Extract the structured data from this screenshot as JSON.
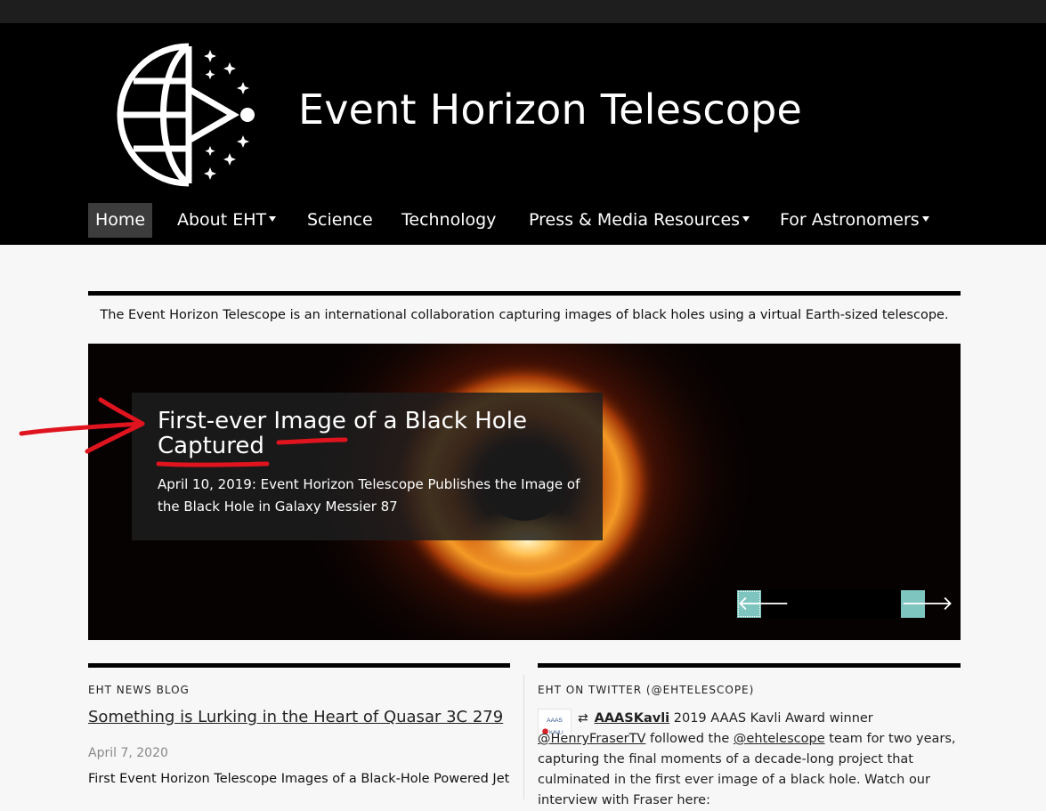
{
  "site": {
    "title": "Event Horizon Telescope"
  },
  "nav": {
    "items": [
      {
        "label": "Home",
        "active": true
      },
      {
        "label": "About EHT",
        "dropdown": true
      },
      {
        "label": "Science"
      },
      {
        "label": "Technology"
      },
      {
        "label": "Press & Media Resources",
        "dropdown": true
      },
      {
        "label": "For Astronomers",
        "dropdown": true
      }
    ]
  },
  "tagline": "The Event Horizon Telescope is an international collaboration capturing images of black holes using a virtual Earth-sized telescope.",
  "hero": {
    "title": "First-ever Image of a Black Hole Captured",
    "subtitle": "April 10, 2019: Event Horizon Telescope Publishes the Image of the Black Hole in Galaxy Messier 87",
    "prev_icon": "arrow-left-icon",
    "next_icon": "arrow-right-icon"
  },
  "blog": {
    "heading": "EHT NEWS BLOG",
    "post_title": "Something is Lurking in the Heart of Quasar 3C 279",
    "post_date": "April 7, 2020",
    "post_summary": "First Event Horizon Telescope Images of a Black-Hole Powered Jet"
  },
  "twitter": {
    "heading": "EHT ON TWITTER (@EHTELESCOPE)",
    "retweet_icon": "retweet-icon",
    "user": "AAASKavli",
    "text_1": "2019 AAAS Kavli Award winner",
    "mention_1": "@HenryFraserTV",
    "text_2": "followed the",
    "mention_2": "@ehtelescope",
    "text_3": "team for two years, capturing the final moments of a decade-long project that culminated in the first ever image of a black hole. Watch our interview with Fraser here:",
    "avatar_line_1": "AAAS",
    "avatar_line_2": "KAVLI"
  },
  "colors": {
    "header_bg": "#000000",
    "accent_teal": "#7fc5bf",
    "annotation_red": "#e0141e"
  }
}
